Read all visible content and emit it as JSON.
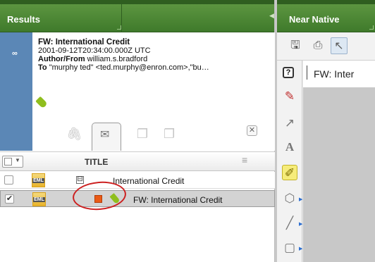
{
  "results_pane": {
    "title": "Results",
    "document": {
      "subject": "FW: International Credit",
      "timestamp": "2001-09-12T20:34:00.000Z UTC",
      "author_label": "Author/From",
      "author_value": "william.s.bradford",
      "to_label": "To",
      "to_value": "\"murphy ted\" <ted.murphy@enron.com>,\"bu…"
    },
    "grid": {
      "column_title": "TITLE",
      "rows": [
        {
          "label": "International Credit",
          "checked": false,
          "icon": "eml-file-icon",
          "expander": "⊟"
        },
        {
          "label": "FW: International Credit",
          "checked": true,
          "icon": "eml-file-icon",
          "expander": ""
        }
      ]
    },
    "file_type_label": "EML"
  },
  "viewer_pane": {
    "title": "Near Native",
    "document_title": "FW: Inter",
    "help_glyph": "?"
  },
  "colors": {
    "header_green": "#4a8533",
    "strip_blue": "#5b87b6",
    "tag_orange": "#ea5a16",
    "tag_green": "#8fbe1e",
    "highlight_ring": "#cc2020"
  }
}
